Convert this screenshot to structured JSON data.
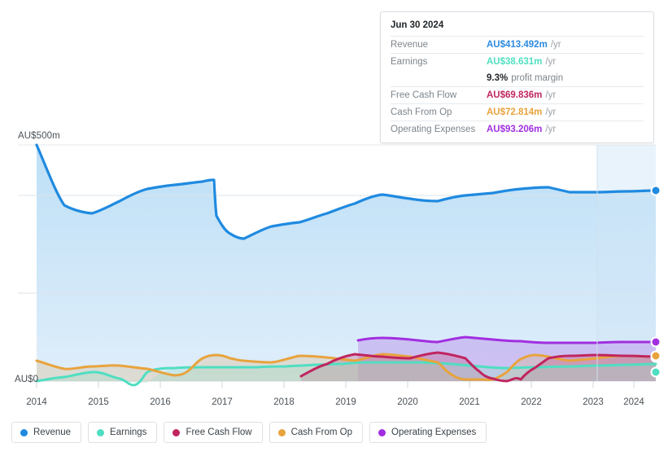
{
  "tooltip": {
    "date": "Jun 30 2024",
    "rows": [
      {
        "label": "Revenue",
        "value": "AU$413.492m",
        "unit": "/yr",
        "color": "#2c8ae0"
      },
      {
        "label": "Earnings",
        "value": "AU$38.631m",
        "unit": "/yr",
        "color": "#4fdec2"
      },
      {
        "label": "",
        "value": "9.3%",
        "unit": "profit margin",
        "color": "#1f2429"
      },
      {
        "label": "Free Cash Flow",
        "value": "AU$69.836m",
        "unit": "/yr",
        "color": "#c0255f"
      },
      {
        "label": "Cash From Op",
        "value": "AU$72.814m",
        "unit": "/yr",
        "color": "#e8a33d"
      },
      {
        "label": "Operating Expenses",
        "value": "AU$93.206m",
        "unit": "/yr",
        "color": "#a12fe0"
      }
    ]
  },
  "axis": {
    "y_top_label": "AU$500m",
    "y_zero_label": "AU$0",
    "x_labels": [
      "2014",
      "2015",
      "2016",
      "2017",
      "2018",
      "2019",
      "2020",
      "2021",
      "2022",
      "2023",
      "2024"
    ]
  },
  "legend": {
    "items": [
      {
        "label": "Revenue",
        "color": "#1f8ae0"
      },
      {
        "label": "Earnings",
        "color": "#4fdec2"
      },
      {
        "label": "Free Cash Flow",
        "color": "#c0255f"
      },
      {
        "label": "Cash From Op",
        "color": "#e8a33d"
      },
      {
        "label": "Operating Expenses",
        "color": "#a12fe0"
      }
    ]
  },
  "chart_data": {
    "type": "area",
    "title": "",
    "xlabel": "",
    "ylabel": "AU$",
    "ylim": [
      0,
      500
    ],
    "ytick_values": [
      0,
      500
    ],
    "ytick_labels": [
      "AU$0",
      "AU$500m"
    ],
    "gridlines_y": [
      0,
      186,
      393,
      500
    ],
    "grid": true,
    "legend_position": "bottom",
    "currency": "AUD",
    "units": "millions per year",
    "x": [
      2014,
      2014.5,
      2015,
      2015.5,
      2016,
      2016.5,
      2017,
      2017.25,
      2017.5,
      2018,
      2018.5,
      2019,
      2019.5,
      2020,
      2020.5,
      2021,
      2021.5,
      2022,
      2022.5,
      2023,
      2023.5,
      2024,
      2024.5
    ],
    "forecast_start": 2023.6,
    "series": [
      {
        "name": "Revenue",
        "color": "#1f8ae0",
        "values": [
          500,
          390,
          372,
          398,
          423,
          432,
          440,
          443,
          350,
          318,
          343,
          352,
          372,
          392,
          383,
          378,
          390,
          395,
          404,
          410,
          400,
          412,
          413.492
        ]
      },
      {
        "name": "Earnings",
        "color": "#4fdec2",
        "values": [
          0,
          8,
          18,
          6,
          -8,
          12,
          28,
          30,
          30,
          30,
          32,
          38,
          41,
          41,
          41,
          40,
          39,
          36,
          33,
          34,
          36,
          38,
          38.631
        ]
      },
      {
        "name": "Free Cash Flow",
        "color": "#c0255f",
        "values": [
          null,
          null,
          null,
          null,
          null,
          null,
          null,
          null,
          null,
          null,
          10,
          26,
          57,
          52,
          48,
          61,
          48,
          18,
          5,
          7,
          60,
          78,
          69.836
        ]
      },
      {
        "name": "Cash From Op",
        "color": "#e8a33d",
        "values": [
          null,
          42,
          26,
          31,
          33,
          25,
          12,
          30,
          55,
          66,
          58,
          51,
          49,
          60,
          58,
          50,
          63,
          52,
          22,
          10,
          11,
          63,
          80,
          72.814
        ]
      },
      {
        "name": "Operating Expenses",
        "color": "#a12fe0",
        "values": [
          null,
          null,
          null,
          null,
          null,
          null,
          null,
          null,
          null,
          null,
          null,
          null,
          87,
          95,
          93,
          90,
          91,
          96,
          94,
          92,
          91,
          92,
          93,
          93.206
        ]
      }
    ]
  }
}
